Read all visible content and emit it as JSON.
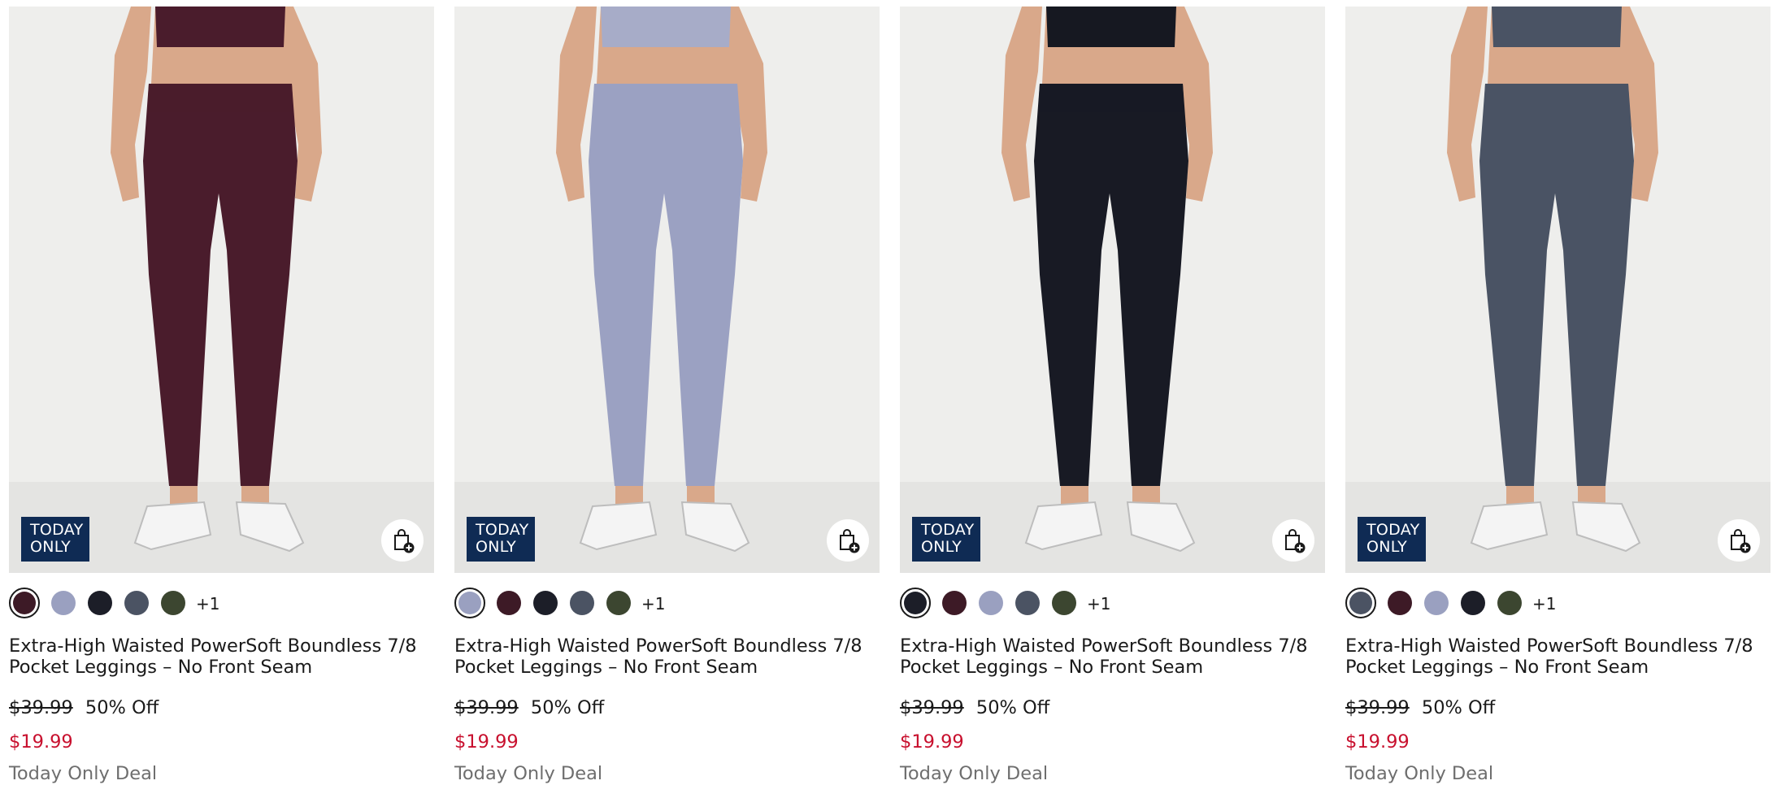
{
  "colors": {
    "badge_bg": "#0f2b54",
    "sale_price": "#c8102e",
    "plum": "#3d1a26",
    "lavender": "#9aa0c0",
    "black": "#1c1e28",
    "slate": "#4b5363",
    "olive": "#3c4630"
  },
  "products": [
    {
      "badge_line1": "TODAY",
      "badge_line2": "ONLY",
      "name": "Extra-High Waisted PowerSoft Boundless 7/8 Pocket Leggings – No Front Seam",
      "original_price": "$39.99",
      "discount": "50% Off",
      "sale_price": "$19.99",
      "deal_label": "Today Only Deal",
      "more_colors": "+1",
      "icons": [
        "add-to-bag-icon"
      ],
      "swatches": [
        "#3d1a26",
        "#9aa0c0",
        "#1c1e28",
        "#4b5363",
        "#3c4630"
      ],
      "legging_color": "#4a1c2c"
    },
    {
      "badge_line1": "TODAY",
      "badge_line2": "ONLY",
      "name": "Extra-High Waisted PowerSoft Boundless 7/8 Pocket Leggings – No Front Seam",
      "original_price": "$39.99",
      "discount": "50% Off",
      "sale_price": "$19.99",
      "deal_label": "Today Only Deal",
      "more_colors": "+1",
      "icons": [
        "add-to-bag-icon"
      ],
      "swatches": [
        "#9aa0c0",
        "#3d1a26",
        "#1c1e28",
        "#4b5363",
        "#3c4630"
      ],
      "legging_color": "#9ba1c2"
    },
    {
      "badge_line1": "TODAY",
      "badge_line2": "ONLY",
      "name": "Extra-High Waisted PowerSoft Boundless 7/8 Pocket Leggings – No Front Seam",
      "original_price": "$39.99",
      "discount": "50% Off",
      "sale_price": "$19.99",
      "deal_label": "Today Only Deal",
      "more_colors": "+1",
      "icons": [
        "add-to-bag-icon"
      ],
      "swatches": [
        "#1c1e28",
        "#3d1a26",
        "#9aa0c0",
        "#4b5363",
        "#3c4630"
      ],
      "legging_color": "#181a24"
    },
    {
      "badge_line1": "TODAY",
      "badge_line2": "ONLY",
      "name": "Extra-High Waisted PowerSoft Boundless 7/8 Pocket Leggings – No Front Seam",
      "original_price": "$39.99",
      "discount": "50% Off",
      "sale_price": "$19.99",
      "deal_label": "Today Only Deal",
      "more_colors": "+1",
      "icons": [
        "add-to-bag-icon"
      ],
      "swatches": [
        "#4b5363",
        "#3d1a26",
        "#9aa0c0",
        "#1c1e28",
        "#3c4630"
      ],
      "legging_color": "#4a5364"
    }
  ]
}
